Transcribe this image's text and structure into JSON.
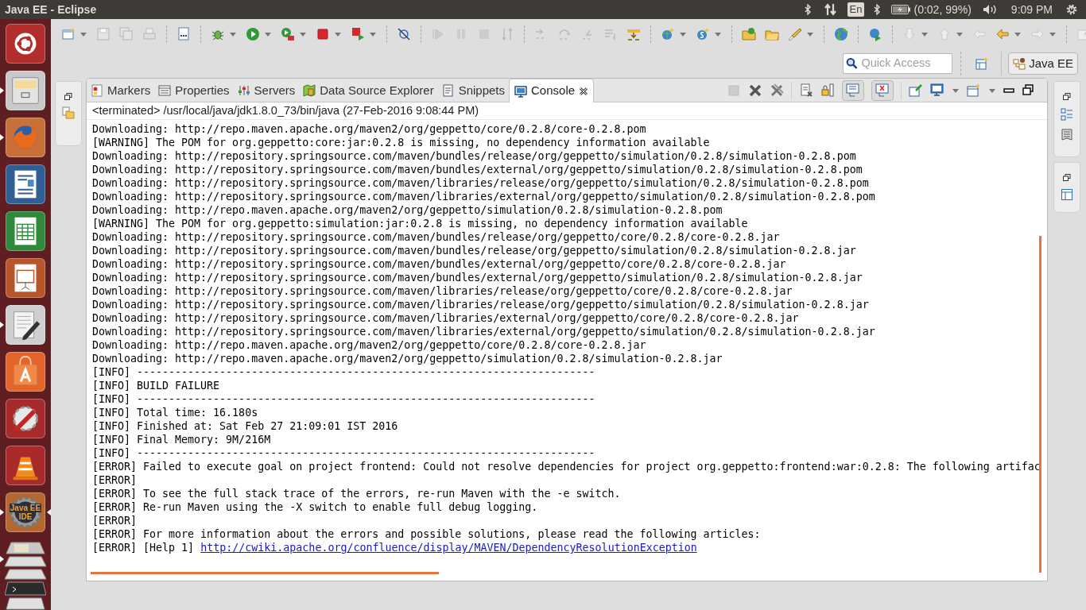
{
  "top_bar": {
    "title": "Java EE - Eclipse",
    "keyboard": "En",
    "battery": "(0:02, 99%)",
    "clock": "9:09 PM"
  },
  "launcher": [
    {
      "kind": "dash",
      "running": false,
      "focused": false
    },
    {
      "kind": "files",
      "running": true,
      "focused": false
    },
    {
      "kind": "firefox",
      "running": true,
      "focused": false
    },
    {
      "kind": "writer",
      "running": false,
      "focused": false
    },
    {
      "kind": "calc",
      "running": false,
      "focused": false
    },
    {
      "kind": "impress",
      "running": false,
      "focused": false
    },
    {
      "kind": "editor",
      "running": true,
      "focused": false
    },
    {
      "kind": "software",
      "running": false,
      "focused": false
    },
    {
      "kind": "settings",
      "running": false,
      "focused": false
    },
    {
      "kind": "vlc",
      "running": false,
      "focused": false
    },
    {
      "kind": "ide",
      "label": "Java EE",
      "label_2": "IDE",
      "running": true,
      "focused": true
    },
    {
      "kind": "stack",
      "running": true,
      "focused": false
    }
  ],
  "quick_access": {
    "placeholder": "Quick Access"
  },
  "perspective": {
    "label": "Java EE"
  },
  "tabs": [
    {
      "label": "Markers",
      "kind": "markers",
      "selected": false
    },
    {
      "label": "Properties",
      "kind": "properties",
      "selected": false
    },
    {
      "label": "Servers",
      "kind": "servers",
      "selected": false
    },
    {
      "label": "Data Source Explorer",
      "kind": "datasource",
      "selected": false
    },
    {
      "label": "Snippets",
      "kind": "snippets",
      "selected": false
    },
    {
      "label": "Console",
      "kind": "console",
      "selected": true
    }
  ],
  "console": {
    "header": "<terminated> /usr/local/java/jdk1.8.0_73/bin/java (27-Feb-2016 9:08:44 PM)",
    "lines": [
      {
        "text": "Downloading: http://repo.maven.apache.org/maven2/org/geppetto/core/0.2.8/core-0.2.8.pom"
      },
      {
        "text": "[WARNING] The POM for org.geppetto:core:jar:0.2.8 is missing, no dependency information available"
      },
      {
        "text": "Downloading: http://repository.springsource.com/maven/bundles/release/org/geppetto/simulation/0.2.8/simulation-0.2.8.pom"
      },
      {
        "text": "Downloading: http://repository.springsource.com/maven/bundles/external/org/geppetto/simulation/0.2.8/simulation-0.2.8.pom"
      },
      {
        "text": "Downloading: http://repository.springsource.com/maven/libraries/release/org/geppetto/simulation/0.2.8/simulation-0.2.8.pom"
      },
      {
        "text": "Downloading: http://repository.springsource.com/maven/libraries/external/org/geppetto/simulation/0.2.8/simulation-0.2.8.pom"
      },
      {
        "text": "Downloading: http://repo.maven.apache.org/maven2/org/geppetto/simulation/0.2.8/simulation-0.2.8.pom"
      },
      {
        "text": "[WARNING] The POM for org.geppetto:simulation:jar:0.2.8 is missing, no dependency information available"
      },
      {
        "text": "Downloading: http://repository.springsource.com/maven/bundles/release/org/geppetto/core/0.2.8/core-0.2.8.jar"
      },
      {
        "text": "Downloading: http://repository.springsource.com/maven/bundles/release/org/geppetto/simulation/0.2.8/simulation-0.2.8.jar"
      },
      {
        "text": "Downloading: http://repository.springsource.com/maven/bundles/external/org/geppetto/core/0.2.8/core-0.2.8.jar"
      },
      {
        "text": "Downloading: http://repository.springsource.com/maven/bundles/external/org/geppetto/simulation/0.2.8/simulation-0.2.8.jar"
      },
      {
        "text": "Downloading: http://repository.springsource.com/maven/libraries/release/org/geppetto/core/0.2.8/core-0.2.8.jar"
      },
      {
        "text": "Downloading: http://repository.springsource.com/maven/libraries/release/org/geppetto/simulation/0.2.8/simulation-0.2.8.jar"
      },
      {
        "text": "Downloading: http://repository.springsource.com/maven/libraries/external/org/geppetto/core/0.2.8/core-0.2.8.jar"
      },
      {
        "text": "Downloading: http://repository.springsource.com/maven/libraries/external/org/geppetto/simulation/0.2.8/simulation-0.2.8.jar"
      },
      {
        "text": "Downloading: http://repo.maven.apache.org/maven2/org/geppetto/core/0.2.8/core-0.2.8.jar"
      },
      {
        "text": "Downloading: http://repo.maven.apache.org/maven2/org/geppetto/simulation/0.2.8/simulation-0.2.8.jar"
      },
      {
        "text": "[INFO] ------------------------------------------------------------------------"
      },
      {
        "text": "[INFO] BUILD FAILURE"
      },
      {
        "text": "[INFO] ------------------------------------------------------------------------"
      },
      {
        "text": "[INFO] Total time: 16.180s"
      },
      {
        "text": "[INFO] Finished at: Sat Feb 27 21:09:01 IST 2016"
      },
      {
        "text": "[INFO] Final Memory: 9M/216M"
      },
      {
        "text": "[INFO] ------------------------------------------------------------------------"
      },
      {
        "text": "[ERROR] Failed to execute goal on project frontend: Could not resolve dependencies for project org.geppetto:frontend:war:0.2.8: The following artifac"
      },
      {
        "text": "[ERROR]"
      },
      {
        "text": "[ERROR] To see the full stack trace of the errors, re-run Maven with the -e switch."
      },
      {
        "text": "[ERROR] Re-run Maven using the -X switch to enable full debug logging."
      },
      {
        "text": "[ERROR]"
      },
      {
        "text": "[ERROR] For more information about the errors and possible solutions, please read the following articles:"
      },
      {
        "text": "[ERROR] [Help 1]",
        "link": "http://cwiki.apache.org/confluence/display/MAVEN/DependencyResolutionException"
      }
    ]
  }
}
